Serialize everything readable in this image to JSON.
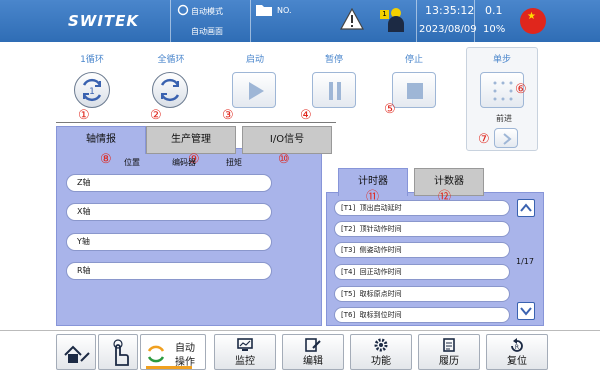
{
  "header": {
    "logo": "SWITEK",
    "mode_label": "自动模式",
    "screen_label": "自动画面",
    "no_label": "NO.",
    "time": "13:35:12",
    "date": "2023/08/09",
    "speed": "0.1",
    "percent": "10%",
    "badge_num": "1"
  },
  "modes": {
    "one_cycle": "1循环",
    "full_cycle": "全循环",
    "start": "启动",
    "pause": "暂停",
    "stop": "停止",
    "step": "单步",
    "forward": "前进"
  },
  "markers": [
    "①",
    "②",
    "③",
    "④",
    "⑤",
    "⑥",
    "⑦",
    "⑧",
    "⑨",
    "⑩",
    "⑪",
    "⑫"
  ],
  "tabs": {
    "axis_info": "轴情报",
    "production": "生产管理",
    "io_signal": "I/O信号"
  },
  "axis_columns": {
    "position": "位置",
    "encoder": "编码器",
    "torque": "扭矩"
  },
  "axes": [
    "Z轴",
    "X轴",
    "Y轴",
    "R轴"
  ],
  "right_tabs": {
    "timer": "计时器",
    "counter": "计数器"
  },
  "timers": [
    {
      "id": "[T1]",
      "label": "顶出启动延时"
    },
    {
      "id": "[T2]",
      "label": "顶针动作时间"
    },
    {
      "id": "[T3]",
      "label": "侧姿动作时间"
    },
    {
      "id": "[T4]",
      "label": "回正动作时间"
    },
    {
      "id": "[T5]",
      "label": "取标原点时间"
    },
    {
      "id": "[T6]",
      "label": "取标到位时间"
    }
  ],
  "page_indicator": "1/17",
  "bottom": {
    "auto_line1": "自动",
    "auto_line2": "操作",
    "monitor": "监控",
    "edit": "编辑",
    "function": "功能",
    "history": "履历",
    "reset": "复位"
  },
  "colors": {
    "header_blue": "#3b78c0",
    "panel_purple": "#a9b4ea",
    "marker_red": "#e0261c",
    "selected_orange": "#f0a020"
  }
}
